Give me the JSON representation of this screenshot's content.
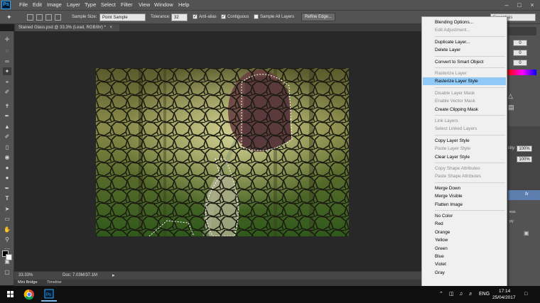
{
  "app": {
    "logo": "Ps",
    "menus": [
      "File",
      "Edit",
      "Image",
      "Layer",
      "Type",
      "Select",
      "Filter",
      "View",
      "Window",
      "Help"
    ],
    "window_controls": [
      "minimize-icon",
      "maximize-icon",
      "close-icon"
    ]
  },
  "options": {
    "sample_size_label": "Sample Size:",
    "sample_size_value": "Point Sample",
    "tolerance_label": "Tolerance:",
    "tolerance_value": "32",
    "anti_alias_label": "Anti-alias",
    "anti_alias_checked": true,
    "contiguous_label": "Contiguous",
    "contiguous_checked": true,
    "sample_all_label": "Sample All Layers",
    "sample_all_checked": false,
    "refine_edge_label": "Refine Edge...",
    "workspace_select": "Essentials"
  },
  "document": {
    "tab_title": "Stained Glass.psd @ 33.3% (Lead, RGB/8#) *",
    "tab_close": "×"
  },
  "status": {
    "zoom": "33.33%",
    "doc_size": "Doc: 7.03M/37.1M"
  },
  "bottom_tabs": [
    "Mini Bridge",
    "Timeline"
  ],
  "right_panel": {
    "field1": "0",
    "field2": "0",
    "field3": "0",
    "opacity_label": "city:",
    "opacity_value": "100%",
    "fill_value": "100%",
    "layer_label1": "ess",
    "layer_label2": "py",
    "fx": "fx"
  },
  "context_menu": {
    "items": [
      {
        "label": "Blending Options...",
        "enabled": true
      },
      {
        "label": "Edit Adjustment...",
        "enabled": false
      },
      {
        "sep": true
      },
      {
        "label": "Duplicate Layer...",
        "enabled": true
      },
      {
        "label": "Delete Layer",
        "enabled": true
      },
      {
        "sep": true
      },
      {
        "label": "Convert to Smart Object",
        "enabled": true
      },
      {
        "sep": true
      },
      {
        "label": "Rasterize Layer",
        "enabled": false
      },
      {
        "label": "Rasterize Layer Style",
        "enabled": true,
        "highlighted": true
      },
      {
        "sep": true
      },
      {
        "label": "Disable Layer Mask",
        "enabled": false
      },
      {
        "label": "Enable Vector Mask",
        "enabled": false
      },
      {
        "label": "Create Clipping Mask",
        "enabled": true
      },
      {
        "sep": true
      },
      {
        "label": "Link Layers",
        "enabled": false
      },
      {
        "label": "Select Linked Layers",
        "enabled": false
      },
      {
        "sep": true
      },
      {
        "label": "Copy Layer Style",
        "enabled": true
      },
      {
        "label": "Paste Layer Style",
        "enabled": false
      },
      {
        "label": "Clear Layer Style",
        "enabled": true
      },
      {
        "sep": true
      },
      {
        "label": "Copy Shape Attributes",
        "enabled": false
      },
      {
        "label": "Paste Shape Attributes",
        "enabled": false
      },
      {
        "sep": true
      },
      {
        "label": "Merge Down",
        "enabled": true
      },
      {
        "label": "Merge Visible",
        "enabled": true
      },
      {
        "label": "Flatten Image",
        "enabled": true
      },
      {
        "sep": true
      },
      {
        "label": "No Color",
        "enabled": true
      },
      {
        "label": "Red",
        "enabled": true
      },
      {
        "label": "Orange",
        "enabled": true
      },
      {
        "label": "Yellow",
        "enabled": true
      },
      {
        "label": "Green",
        "enabled": true
      },
      {
        "label": "Blue",
        "enabled": true
      },
      {
        "label": "Violet",
        "enabled": true
      },
      {
        "label": "Gray",
        "enabled": true
      }
    ]
  },
  "taskbar": {
    "lang": "ENG",
    "time": "17:14",
    "date": "25/04/2017"
  },
  "colors": {
    "highlight": "#91c9f7",
    "ps_blue": "#31a8ff",
    "ui_gray": "#535353"
  }
}
